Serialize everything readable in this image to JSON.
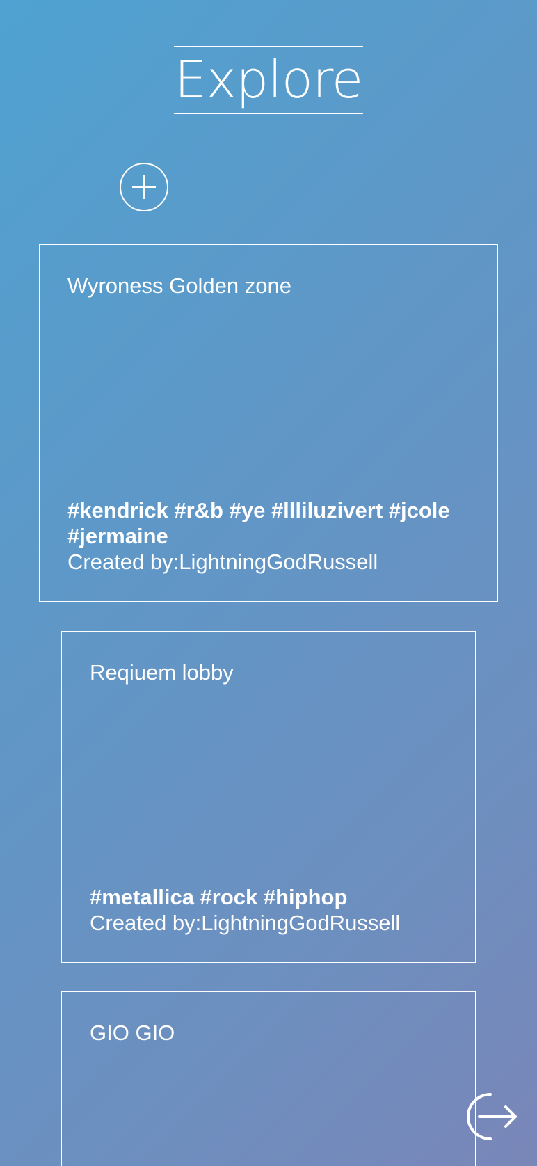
{
  "header": {
    "title": "Explore"
  },
  "icons": {
    "add": "plus-circle-icon",
    "logout": "logout-arrow-icon"
  },
  "rooms": [
    {
      "name": "Wyroness Golden zone",
      "tags": "#kendrick #r&b #ye #llliluzivert #jcole #jermaine",
      "creator": "Created by:LightningGodRussell"
    },
    {
      "name": "Reqiuem lobby",
      "tags": "#metallica #rock #hiphop",
      "creator": "Created by:LightningGodRussell"
    },
    {
      "name": "GIO GIO"
    }
  ],
  "colors": {
    "gradient_start": "#4fa2d1",
    "gradient_end": "#7986b8",
    "foreground": "#ffffff"
  }
}
